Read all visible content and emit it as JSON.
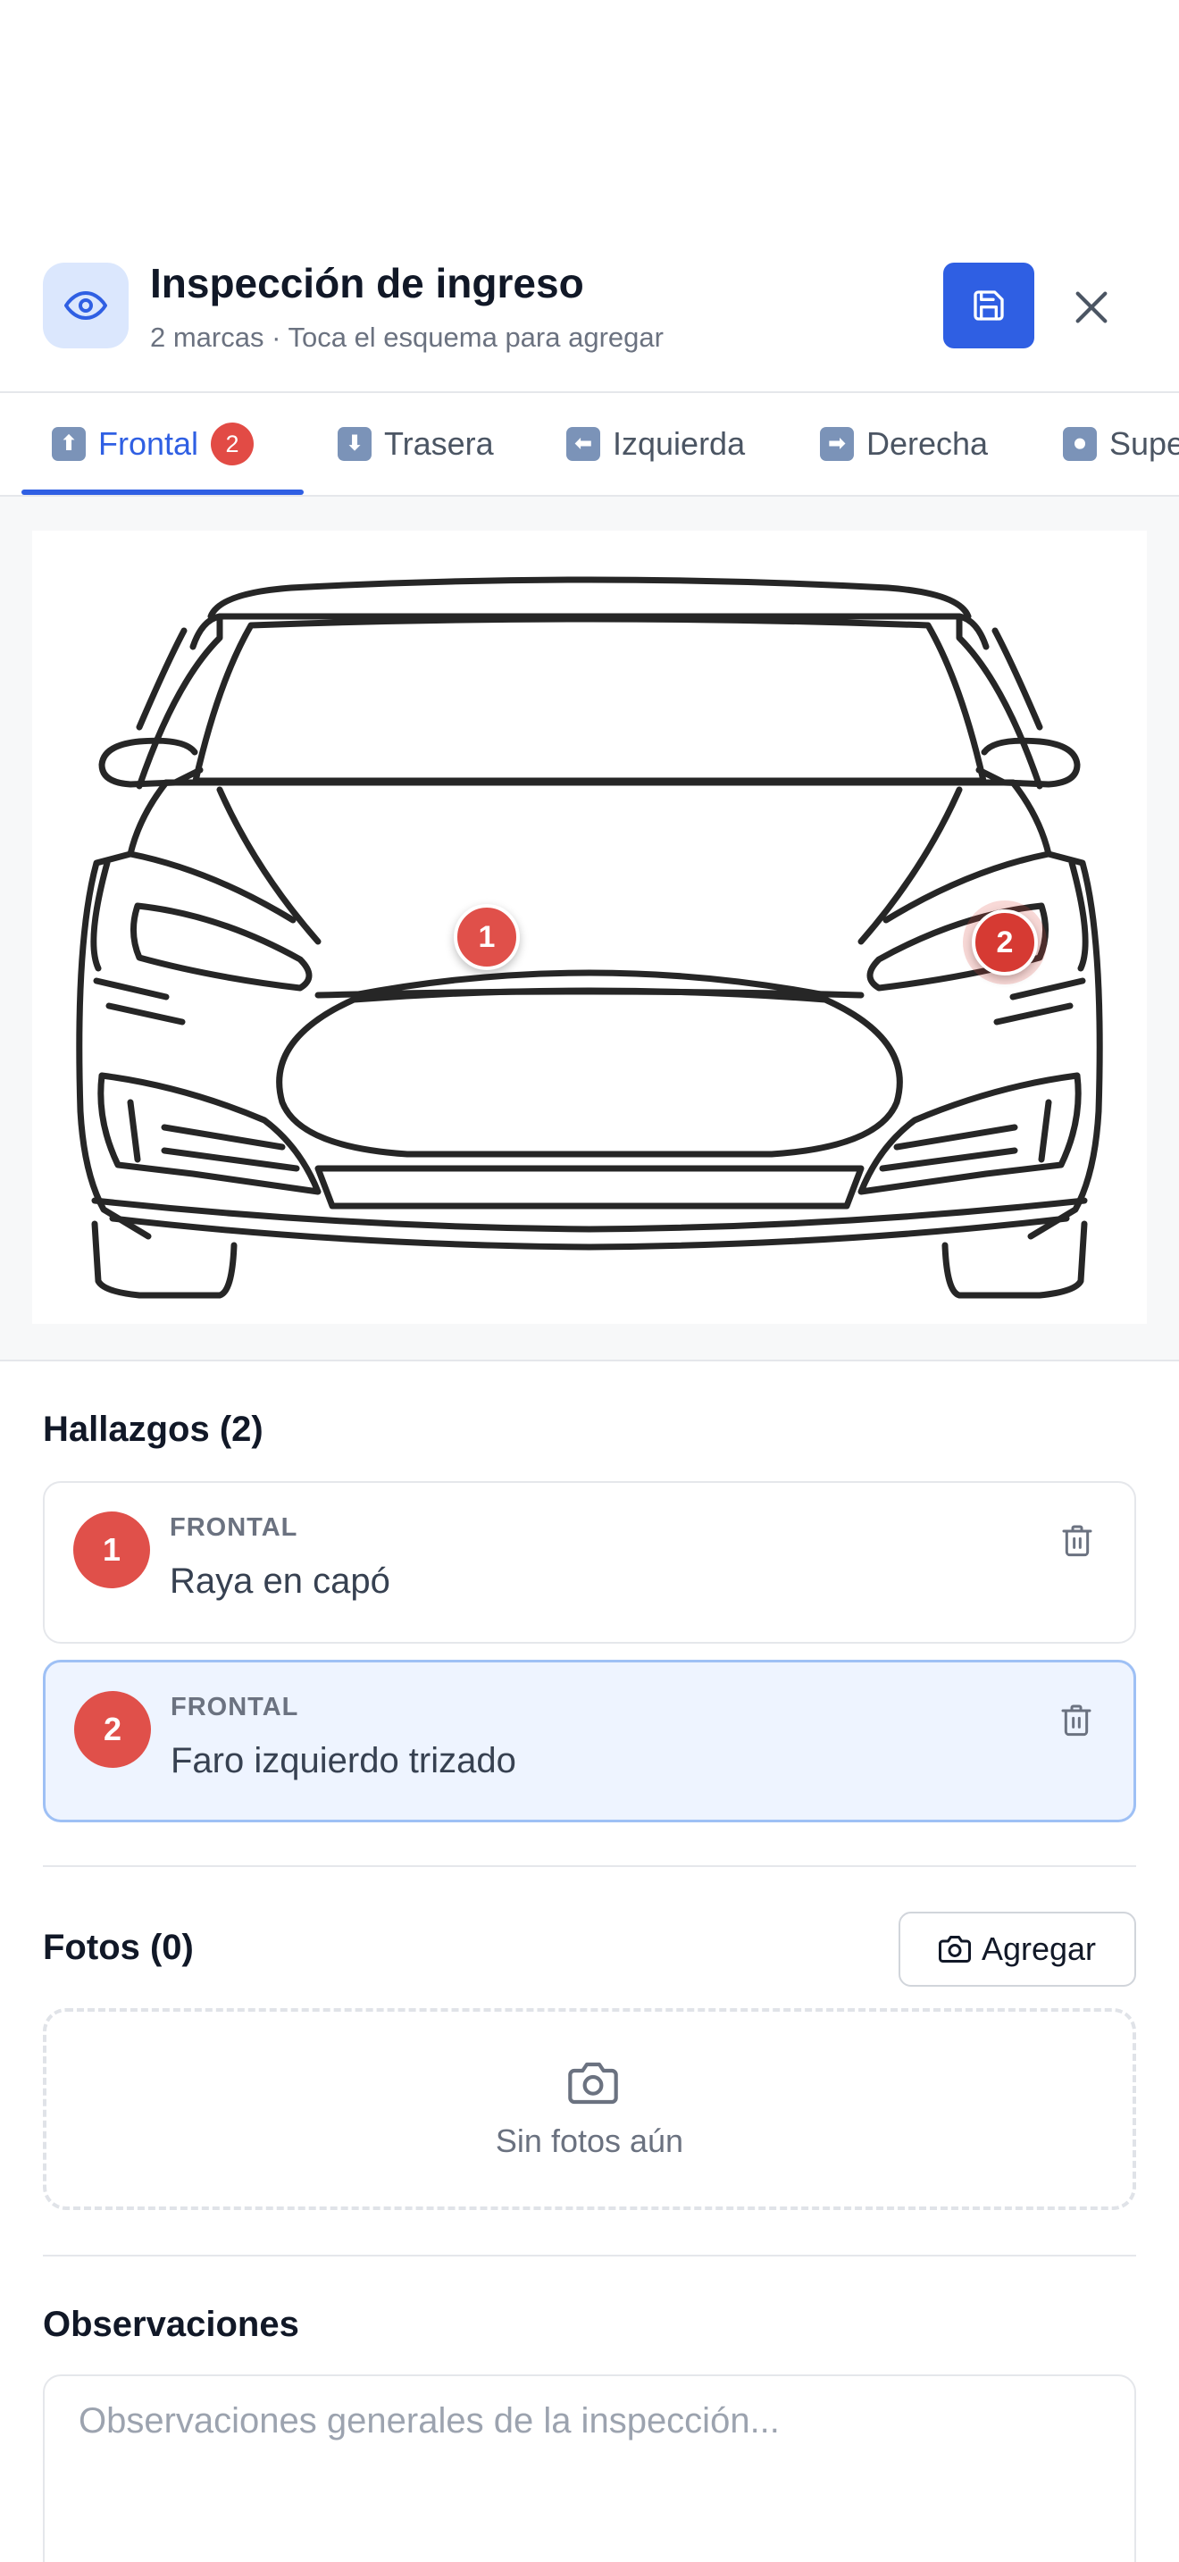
{
  "header": {
    "title": "Inspección de ingreso",
    "subtitle": "2 marcas · Toca el esquema para agregar",
    "icon": "eye-icon",
    "save_icon": "floppy-disk-icon",
    "close_icon": "close-icon"
  },
  "tabs": [
    {
      "label": "Frontal",
      "emoji": "⬆",
      "count": "2",
      "active": true
    },
    {
      "label": "Trasera",
      "emoji": "⬇",
      "active": false
    },
    {
      "label": "Izquierda",
      "emoji": "⬅",
      "active": false
    },
    {
      "label": "Derecha",
      "emoji": "➡",
      "active": false
    },
    {
      "label": "Superior",
      "emoji": "⏺",
      "active": false
    }
  ],
  "diagram": {
    "markers": [
      {
        "number": "1"
      },
      {
        "number": "2",
        "selected": true
      }
    ]
  },
  "findings": {
    "title": "Hallazgos (2)",
    "items": [
      {
        "number": "1",
        "view": "FRONTAL",
        "description": "Raya en capó",
        "selected": false
      },
      {
        "number": "2",
        "view": "FRONTAL",
        "description": "Faro izquierdo trizado",
        "selected": true
      }
    ]
  },
  "photos": {
    "title": "Fotos (0)",
    "add_label": "Agregar",
    "empty_text": "Sin fotos aún"
  },
  "observations": {
    "title": "Observaciones",
    "placeholder": "Observaciones generales de la inspección...",
    "value": ""
  },
  "colors": {
    "accent": "#2f5fe3",
    "marker": "#e0504a",
    "selected_bg": "#eef4ff"
  }
}
